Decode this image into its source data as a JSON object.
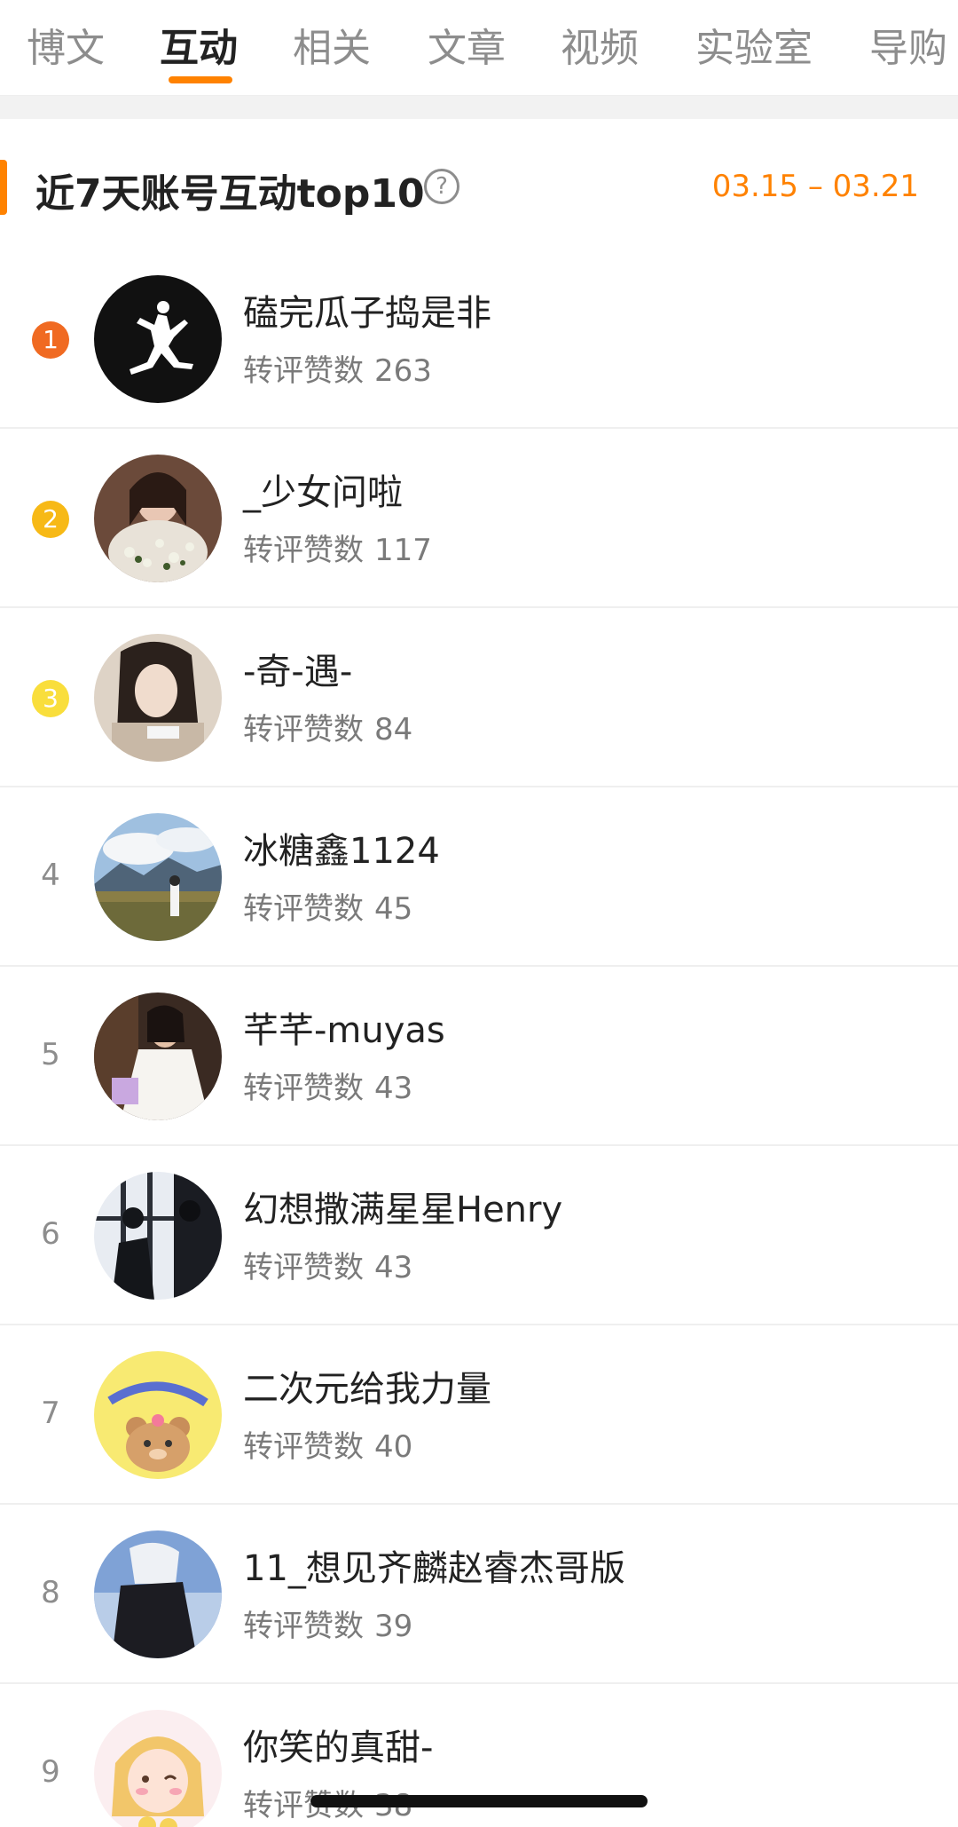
{
  "tabs": [
    {
      "label": "博文",
      "active": false
    },
    {
      "label": "互动",
      "active": true
    },
    {
      "label": "相关",
      "active": false
    },
    {
      "label": "文章",
      "active": false
    },
    {
      "label": "视频",
      "active": false
    },
    {
      "label": "实验室",
      "active": false
    },
    {
      "label": "导购",
      "active": false
    }
  ],
  "section": {
    "title": "近7天账号互动top10",
    "help_icon": "question-circle-icon",
    "date_range": "03.15 – 03.21"
  },
  "colors": {
    "accent": "#ff8200",
    "rank1": "#f06a22",
    "rank2": "#f7b916",
    "rank3": "#f9de3c"
  },
  "stat_label": "转评赞数",
  "ranking": [
    {
      "rank": "1",
      "name": "磕完瓜子捣是非",
      "count": "263",
      "avatar": "jumpman-logo"
    },
    {
      "rank": "2",
      "name": "_少女问啦",
      "count": "117",
      "avatar": "girl-with-flowers"
    },
    {
      "rank": "3",
      "name": "-奇-遇-",
      "count": "84",
      "avatar": "girl-portrait"
    },
    {
      "rank": "4",
      "name": "冰糖鑫1124",
      "count": "45",
      "avatar": "mountain-landscape"
    },
    {
      "rank": "5",
      "name": "芊芊-muyas",
      "count": "43",
      "avatar": "girl-white-dress"
    },
    {
      "rank": "6",
      "name": "幻想撒满星星Henry",
      "count": "43",
      "avatar": "silhouette-window"
    },
    {
      "rank": "7",
      "name": "二次元给我力量",
      "count": "40",
      "avatar": "cartoon-bear-happy"
    },
    {
      "rank": "8",
      "name": "11_想见齐麟赵睿杰哥版",
      "count": "39",
      "avatar": "winter-person"
    },
    {
      "rank": "9",
      "name": "你笑的真甜-",
      "count": "38",
      "avatar": "cartoon-girl"
    }
  ]
}
